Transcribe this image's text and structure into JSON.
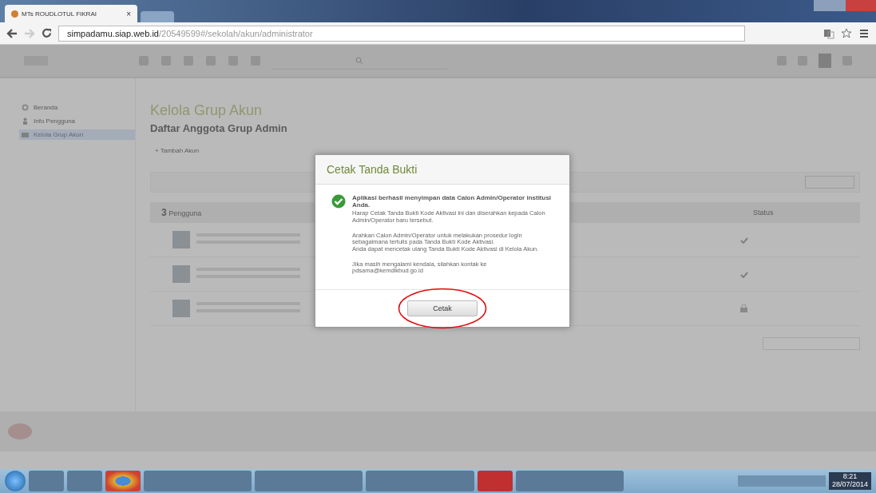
{
  "browser": {
    "tabs": [
      {
        "title": "MTs ROUDLOTUL FIKRAI",
        "close": "×",
        "selected": true
      },
      {
        "selected": false
      }
    ],
    "url_host": "simpadamu.siap.web.id",
    "url_path": "/20549599#/sekolah/akun/administrator"
  },
  "sidebar": {
    "items": [
      {
        "label": "Beranda",
        "kind": "home",
        "selected": false
      },
      {
        "label": "Info Pengguna",
        "kind": "profile",
        "selected": false
      },
      {
        "label": "Kelola Grup Akun",
        "kind": "group",
        "selected": true
      }
    ]
  },
  "page": {
    "title": "Kelola Grup Akun",
    "subtitle": "Daftar Anggota Grup Admin",
    "add_button": "+ Tambah Akun"
  },
  "table": {
    "count": "3",
    "count_label": "Pengguna",
    "status_header": "Status",
    "rows": [
      {
        "kind": "active"
      },
      {
        "kind": "active"
      },
      {
        "kind": "locked"
      }
    ]
  },
  "dialog": {
    "title": "Cetak Tanda Bukti",
    "message": "Aplikasi berhasil menyimpan data Calon Admin/Operator institusi Anda.",
    "paragraphs": [
      "Harap Cetak Tanda Bukti Kode Aktivasi ini dan diserahkan kepada Calon Admin/Operator baru tersebut.",
      "Arahkan Calon Admin/Operator untuk melakukan prosedur login sebagaimana tertulis pada Tanda Bukti Kode Aktivasi.\nAnda dapat mencetak ulang Tanda Bukti Kode Aktivasi di Kelola Akun.",
      "Jika masih mengalami kendala, silahkan kontak ke pdsama@kemdikbud.go.id"
    ],
    "button": "Cetak",
    "highlighted": true
  },
  "taskbar": {
    "time": "8:21",
    "date": "28/07/2014"
  }
}
